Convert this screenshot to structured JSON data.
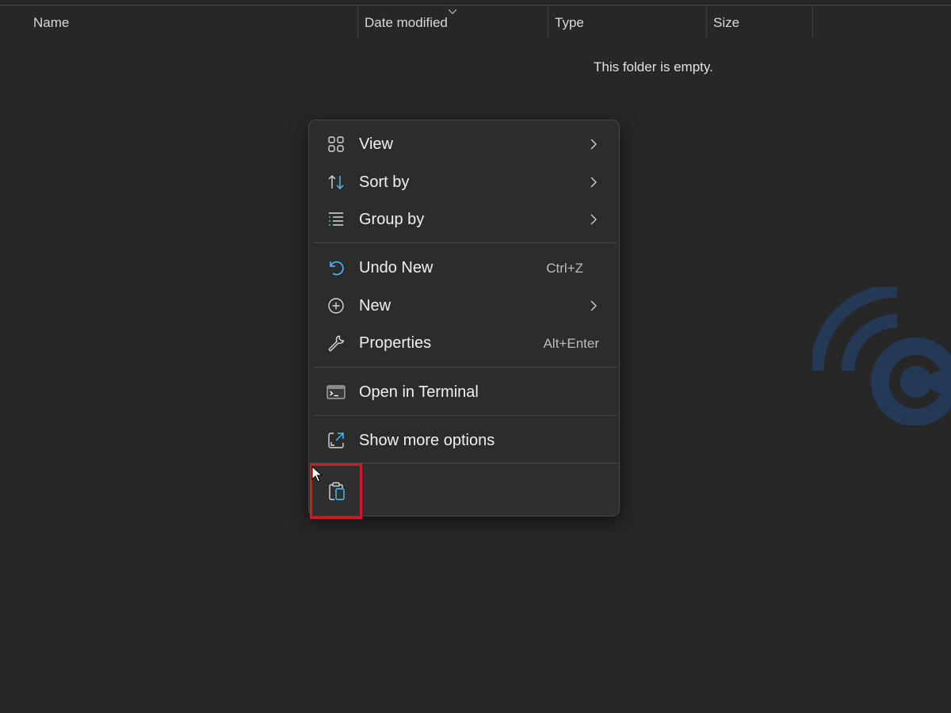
{
  "columns": [
    {
      "label": "Name"
    },
    {
      "label": "Date modified"
    },
    {
      "label": "Type"
    },
    {
      "label": "Size"
    }
  ],
  "empty_message": "This folder is empty.",
  "context_menu": {
    "items": [
      {
        "label": "View",
        "icon": "view-grid-icon",
        "submenu": true
      },
      {
        "label": "Sort by",
        "icon": "sort-icon",
        "submenu": true
      },
      {
        "label": "Group by",
        "icon": "group-list-icon",
        "submenu": true
      },
      {
        "label": "Undo New",
        "icon": "undo-icon",
        "shortcut": "Ctrl+Z"
      },
      {
        "label": "New",
        "icon": "plus-circle-icon",
        "submenu": true
      },
      {
        "label": "Properties",
        "icon": "wrench-icon",
        "shortcut": "Alt+Enter"
      },
      {
        "label": "Open in Terminal",
        "icon": "terminal-icon"
      },
      {
        "label": "Show more options",
        "icon": "expand-icon"
      }
    ],
    "toolbar": [
      {
        "icon": "paste-icon",
        "highlighted": true
      }
    ]
  },
  "colors": {
    "background": "#272727",
    "menu_background": "#2c2c2c",
    "accent_blue": "#4cc2ff",
    "highlight_border": "#d11b24",
    "watermark": "#243955"
  }
}
